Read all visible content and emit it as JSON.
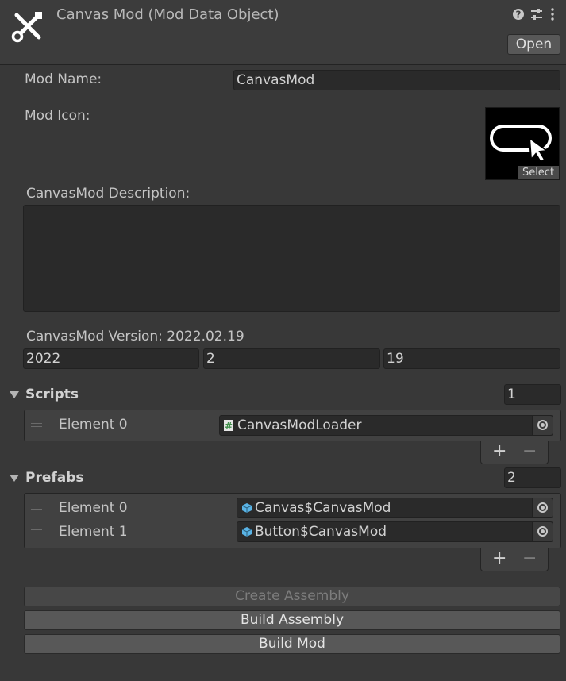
{
  "header": {
    "title": "Canvas Mod (Mod Data Object)",
    "help_icon": "help-icon",
    "settings_icon": "sliders-icon",
    "menu_icon": "kebab-menu-icon",
    "open_label": "Open"
  },
  "mod_name": {
    "label": "Mod Name:",
    "value": "CanvasMod"
  },
  "mod_icon": {
    "label": "Mod Icon:",
    "select_label": "Select"
  },
  "description": {
    "label": "CanvasMod Description:",
    "value": ""
  },
  "version": {
    "label": "CanvasMod Version: 2022.02.19",
    "major": "2022",
    "minor": "2",
    "patch": "19"
  },
  "scripts": {
    "label": "Scripts",
    "count": "1",
    "items": [
      {
        "label": "Element 0",
        "value": "CanvasModLoader",
        "icon": "csharp-script-icon"
      }
    ],
    "add": "+",
    "remove": "−"
  },
  "prefabs": {
    "label": "Prefabs",
    "count": "2",
    "items": [
      {
        "label": "Element 0",
        "value": "Canvas$CanvasMod",
        "icon": "prefab-cube-icon"
      },
      {
        "label": "Element 1",
        "value": "Button$CanvasMod",
        "icon": "prefab-cube-icon"
      }
    ],
    "add": "+",
    "remove": "−"
  },
  "actions": {
    "create_assembly": "Create Assembly",
    "build_assembly": "Build Assembly",
    "build_mod": "Build Mod"
  },
  "colors": {
    "background": "#383838",
    "field": "#2a2a2a",
    "button": "#585858",
    "prefab_icon": "#5ab4e6",
    "script_icon": "#3f8f4a"
  }
}
